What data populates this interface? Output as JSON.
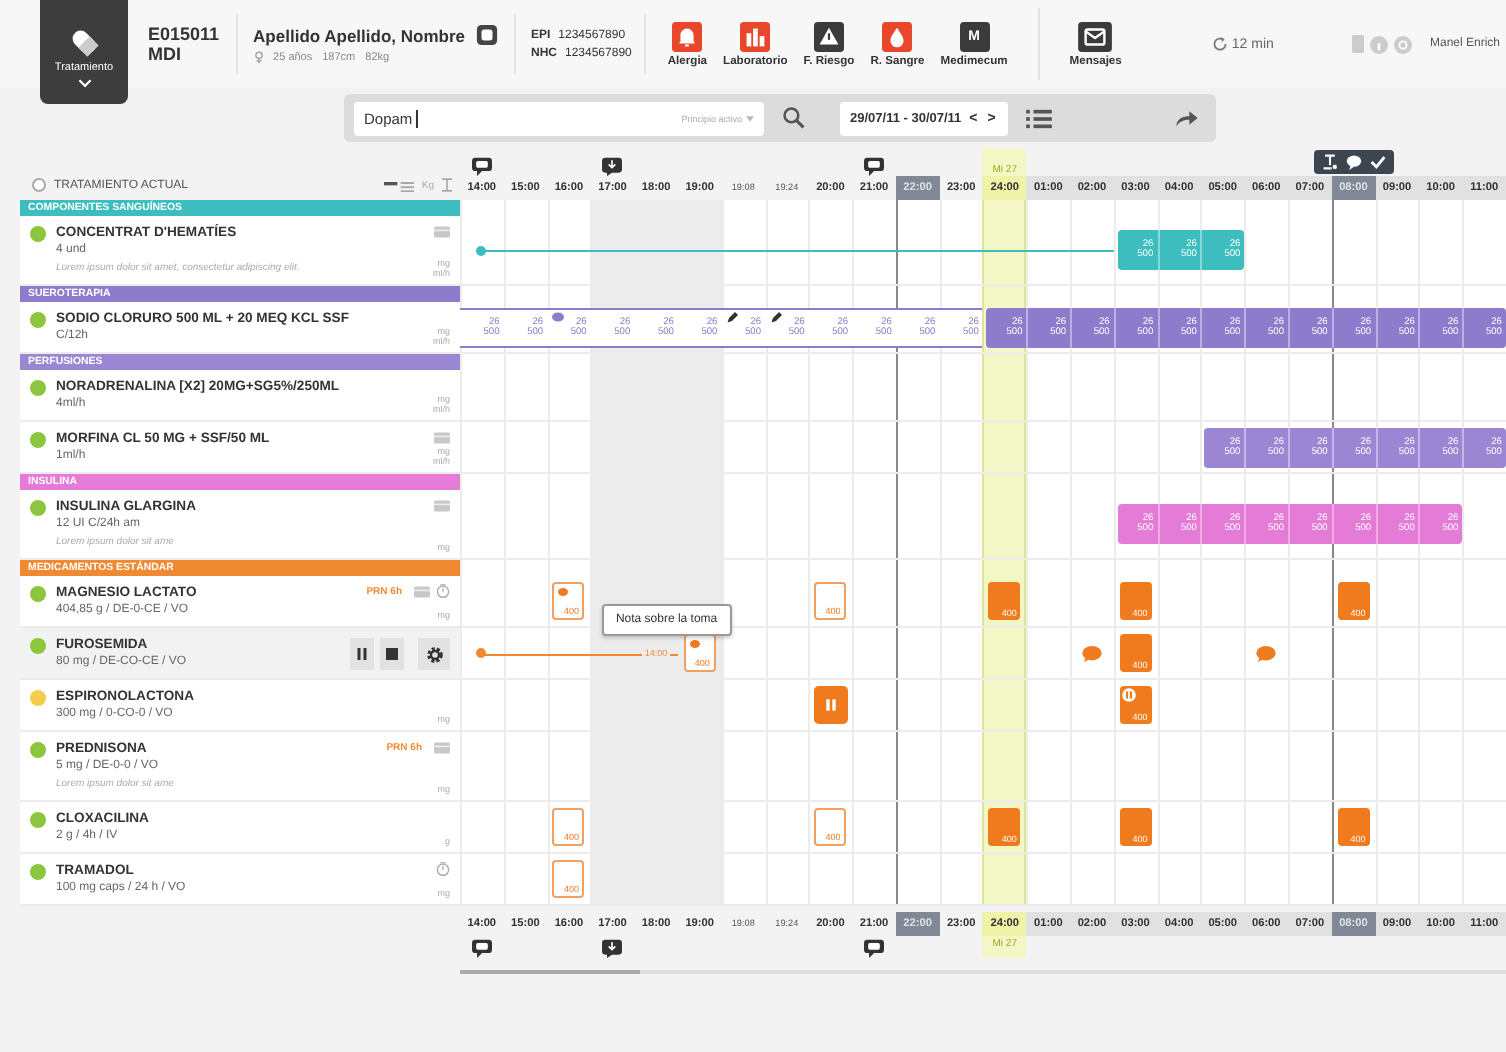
{
  "header": {
    "tab": {
      "label": "Tratamiento"
    },
    "bed": {
      "code": "E015011",
      "unit": "MDI"
    },
    "patient": {
      "name": "Apellido Apellido, Nombre",
      "age": "25 años",
      "height": "187cm",
      "weight": "82kg"
    },
    "ids": [
      {
        "label": "EPI",
        "value": "1234567890"
      },
      {
        "label": "NHC",
        "value": "1234567890"
      }
    ],
    "shortcuts": [
      {
        "label": "Alergia",
        "kind": "bell",
        "alert": true
      },
      {
        "label": "Laboratorio",
        "kind": "chart",
        "alert": true
      },
      {
        "label": "F. Riesgo",
        "kind": "warning",
        "alert": false
      },
      {
        "label": "R. Sangre",
        "kind": "drop",
        "alert": true
      },
      {
        "label": "Medimecum",
        "kind": "letter",
        "glyph": "M",
        "alert": false
      }
    ],
    "messages": {
      "label": "Mensajes"
    },
    "refresh": "12 min",
    "user": "Manel Enrich"
  },
  "search": {
    "value": "Dopam",
    "filter": "Principio activo",
    "dates": "29/07/11 - 30/07/11",
    "prev": "<",
    "next": ">"
  },
  "list_header": {
    "title": "TRATAMIENTO ACTUAL",
    "checked": false,
    "weight_unit": "Kg"
  },
  "columns": [
    {
      "label": "14:00",
      "kind": "hour",
      "flag": {
        "kind": "comment"
      },
      "shaded": false
    },
    {
      "label": "15:00",
      "kind": "hour",
      "shaded": false
    },
    {
      "label": "16:00",
      "kind": "hour",
      "shaded": false
    },
    {
      "label": "17:00",
      "kind": "hour",
      "flag": {
        "kind": "download"
      },
      "shaded": true
    },
    {
      "label": "18:00",
      "kind": "hour",
      "shaded": true
    },
    {
      "label": "19:00",
      "kind": "hour",
      "shaded": true
    },
    {
      "label": "19:08",
      "kind": "sub",
      "shaded": false
    },
    {
      "label": "19:24",
      "kind": "sub",
      "shaded": false
    },
    {
      "label": "20:00",
      "kind": "hour",
      "shaded": false
    },
    {
      "label": "21:00",
      "kind": "hour",
      "flag": {
        "kind": "comment"
      },
      "shaded": false
    },
    {
      "label": "22:00",
      "kind": "marker",
      "shaded": false
    },
    {
      "label": "23:00",
      "kind": "hour",
      "shaded": false
    },
    {
      "label": "24:00",
      "kind": "now",
      "day": "Mi 27",
      "shaded": false
    },
    {
      "label": "01:00",
      "kind": "next",
      "shaded": false
    },
    {
      "label": "02:00",
      "kind": "next",
      "shaded": false
    },
    {
      "label": "03:00",
      "kind": "next",
      "shaded": false
    },
    {
      "label": "04:00",
      "kind": "next",
      "shaded": false
    },
    {
      "label": "05:00",
      "kind": "next",
      "shaded": false
    },
    {
      "label": "06:00",
      "kind": "next",
      "shaded": false
    },
    {
      "label": "07:00",
      "kind": "next",
      "shaded": false
    },
    {
      "label": "08:00",
      "kind": "marker",
      "toolbar": true,
      "shaded": false
    },
    {
      "label": "09:00",
      "kind": "next",
      "shaded": false
    },
    {
      "label": "10:00",
      "kind": "next",
      "shaded": false
    },
    {
      "label": "11:00",
      "kind": "next",
      "shaded": false
    }
  ],
  "rows": [
    {
      "kind": "category",
      "label": "COMPONENTES SANGUÍNEOS",
      "color": "#3dbdbd"
    },
    {
      "kind": "drug",
      "color": "#8cc63f",
      "name": "CONCENTRAT D'HEMATÍES",
      "detail": "4 und",
      "note": "Lorem ipsum dolor sit amet, consectetur adipiscing elit.",
      "card": true,
      "timer": false,
      "units": [
        "mg",
        "ml/h"
      ],
      "hovered": false,
      "cells": [
        {
          "kind": "line-start"
        },
        {
          "kind": "line"
        },
        {
          "kind": "line"
        },
        {
          "kind": "line"
        },
        {
          "kind": "line"
        },
        {
          "kind": "line"
        },
        {
          "kind": "line"
        },
        {
          "kind": "line"
        },
        {
          "kind": "line"
        },
        {
          "kind": "line"
        },
        {
          "kind": "line"
        },
        {
          "kind": "line"
        },
        {
          "kind": "line"
        },
        {
          "kind": "line"
        },
        {
          "kind": "line"
        },
        {
          "kind": "bar",
          "dose": "26",
          "volume": "500"
        },
        {
          "kind": "bar",
          "dose": "26",
          "volume": "500"
        },
        {
          "kind": "bar",
          "dose": "26",
          "volume": "500"
        },
        {
          "kind": "none"
        },
        {
          "kind": "none"
        },
        {
          "kind": "none"
        },
        {
          "kind": "none"
        },
        {
          "kind": "none"
        },
        {
          "kind": "none"
        }
      ]
    },
    {
      "kind": "category",
      "label": "SUEROTERAPIA",
      "color": "#8d7bcb"
    },
    {
      "kind": "drug",
      "color": "#8cc63f",
      "name": "SODIO CLORURO 500 ML + 20 MEQ KCL SSF",
      "detail": "C/12h",
      "card": false,
      "timer": false,
      "units": [
        "mg",
        "ml/h"
      ],
      "hovered": false,
      "cells": [
        {
          "kind": "light",
          "dose": "26",
          "volume": "500"
        },
        {
          "kind": "light",
          "dose": "26",
          "volume": "500"
        },
        {
          "kind": "light",
          "dose": "26",
          "volume": "500",
          "annotation": {
            "kind": "comment"
          }
        },
        {
          "kind": "light",
          "dose": "26",
          "volume": "500"
        },
        {
          "kind": "light",
          "dose": "26",
          "volume": "500"
        },
        {
          "kind": "light",
          "dose": "26",
          "volume": "500"
        },
        {
          "kind": "light",
          "dose": "26",
          "volume": "500",
          "annotation": {
            "kind": "pencil"
          }
        },
        {
          "kind": "light",
          "dose": "26",
          "volume": "500",
          "annotation": {
            "kind": "pencil"
          }
        },
        {
          "kind": "light",
          "dose": "26",
          "volume": "500"
        },
        {
          "kind": "light",
          "dose": "26",
          "volume": "500"
        },
        {
          "kind": "light",
          "dose": "26",
          "volume": "500"
        },
        {
          "kind": "light",
          "dose": "26",
          "volume": "500"
        },
        {
          "kind": "bar",
          "dose": "26",
          "volume": "500"
        },
        {
          "kind": "bar",
          "dose": "26",
          "volume": "500"
        },
        {
          "kind": "bar",
          "dose": "26",
          "volume": "500"
        },
        {
          "kind": "bar",
          "dose": "26",
          "volume": "500"
        },
        {
          "kind": "bar",
          "dose": "26",
          "volume": "500"
        },
        {
          "kind": "bar",
          "dose": "26",
          "volume": "500"
        },
        {
          "kind": "bar",
          "dose": "26",
          "volume": "500"
        },
        {
          "kind": "bar",
          "dose": "26",
          "volume": "500"
        },
        {
          "kind": "bar",
          "dose": "26",
          "volume": "500"
        },
        {
          "kind": "bar",
          "dose": "26",
          "volume": "500"
        },
        {
          "kind": "bar",
          "dose": "26",
          "volume": "500"
        },
        {
          "kind": "bar",
          "dose": "26",
          "volume": "500"
        }
      ]
    },
    {
      "kind": "category",
      "label": "PERFUSIONES",
      "color": "#9a86d3"
    },
    {
      "kind": "drug",
      "color": "#8cc63f",
      "name": "NORADRENALINA [X2] 20MG+SG5%/250ML",
      "detail": "4ml/h",
      "card": false,
      "timer": false,
      "units": [
        "mg",
        "ml/h"
      ],
      "hovered": false,
      "cells": [
        {
          "kind": "none"
        },
        {
          "kind": "none"
        },
        {
          "kind": "none"
        },
        {
          "kind": "none"
        },
        {
          "kind": "none"
        },
        {
          "kind": "none"
        },
        {
          "kind": "none"
        },
        {
          "kind": "none"
        },
        {
          "kind": "none"
        },
        {
          "kind": "none"
        },
        {
          "kind": "none"
        },
        {
          "kind": "none"
        },
        {
          "kind": "none"
        },
        {
          "kind": "none"
        },
        {
          "kind": "none"
        },
        {
          "kind": "none"
        },
        {
          "kind": "none"
        },
        {
          "kind": "none"
        },
        {
          "kind": "none"
        },
        {
          "kind": "none"
        },
        {
          "kind": "none"
        },
        {
          "kind": "none"
        },
        {
          "kind": "none"
        },
        {
          "kind": "none"
        }
      ]
    },
    {
      "kind": "drug",
      "color": "#8cc63f",
      "name": "MORFINA CL 50 MG + SSF/50 ML",
      "detail": "1ml/h",
      "card": true,
      "timer": false,
      "units": [
        "mg",
        "ml/h"
      ],
      "hovered": false,
      "cells": [
        {
          "kind": "none"
        },
        {
          "kind": "none"
        },
        {
          "kind": "none"
        },
        {
          "kind": "none"
        },
        {
          "kind": "none"
        },
        {
          "kind": "none"
        },
        {
          "kind": "none"
        },
        {
          "kind": "none"
        },
        {
          "kind": "none"
        },
        {
          "kind": "none"
        },
        {
          "kind": "none"
        },
        {
          "kind": "none"
        },
        {
          "kind": "none"
        },
        {
          "kind": "none"
        },
        {
          "kind": "none"
        },
        {
          "kind": "none"
        },
        {
          "kind": "none"
        },
        {
          "kind": "bar",
          "dose": "26",
          "volume": "500"
        },
        {
          "kind": "bar",
          "dose": "26",
          "volume": "500"
        },
        {
          "kind": "bar",
          "dose": "26",
          "volume": "500"
        },
        {
          "kind": "bar",
          "dose": "26",
          "volume": "500"
        },
        {
          "kind": "bar",
          "dose": "26",
          "volume": "500"
        },
        {
          "kind": "bar",
          "dose": "26",
          "volume": "500"
        },
        {
          "kind": "bar",
          "dose": "26",
          "volume": "500"
        }
      ]
    },
    {
      "kind": "category",
      "label": "INSULINA",
      "color": "#e37bd7"
    },
    {
      "kind": "drug",
      "color": "#8cc63f",
      "name": "INSULINA GLARGINA",
      "detail": "12 UI C/24h am",
      "note": "Lorem ipsum dolor sit ame",
      "card": true,
      "timer": false,
      "units": [
        "mg"
      ],
      "hovered": false,
      "cells": [
        {
          "kind": "none"
        },
        {
          "kind": "none"
        },
        {
          "kind": "none"
        },
        {
          "kind": "none"
        },
        {
          "kind": "none"
        },
        {
          "kind": "none"
        },
        {
          "kind": "none"
        },
        {
          "kind": "none"
        },
        {
          "kind": "none"
        },
        {
          "kind": "none"
        },
        {
          "kind": "none"
        },
        {
          "kind": "none"
        },
        {
          "kind": "none"
        },
        {
          "kind": "none"
        },
        {
          "kind": "none"
        },
        {
          "kind": "bar",
          "dose": "26",
          "volume": "500"
        },
        {
          "kind": "bar",
          "dose": "26",
          "volume": "500"
        },
        {
          "kind": "bar",
          "dose": "26",
          "volume": "500"
        },
        {
          "kind": "bar",
          "dose": "26",
          "volume": "500"
        },
        {
          "kind": "bar",
          "dose": "26",
          "volume": "500"
        },
        {
          "kind": "bar",
          "dose": "26",
          "volume": "500"
        },
        {
          "kind": "bar",
          "dose": "26",
          "volume": "500"
        },
        {
          "kind": "bar",
          "dose": "26",
          "volume": "500"
        },
        {
          "kind": "none"
        }
      ]
    },
    {
      "kind": "category",
      "label": "MEDICAMENTOS ESTÁNDAR",
      "color": "#f08a32"
    },
    {
      "kind": "drug",
      "color": "#8cc63f",
      "name": "MAGNESIO LACTATO",
      "detail": "404,85 g / DE-0-CE / VO",
      "prn": "PRN 6h",
      "card": true,
      "timer": true,
      "units": [
        "mg"
      ],
      "hovered": false,
      "cells": [
        {
          "kind": "none"
        },
        {
          "kind": "none"
        },
        {
          "kind": "outline",
          "amount": "400",
          "dot": true
        },
        {
          "kind": "none"
        },
        {
          "kind": "none"
        },
        {
          "kind": "none"
        },
        {
          "kind": "none"
        },
        {
          "kind": "none"
        },
        {
          "kind": "outline",
          "amount": "400",
          "dot": false
        },
        {
          "kind": "none"
        },
        {
          "kind": "none"
        },
        {
          "kind": "none"
        },
        {
          "kind": "filled",
          "amount": "400"
        },
        {
          "kind": "none"
        },
        {
          "kind": "none"
        },
        {
          "kind": "filled",
          "amount": "400"
        },
        {
          "kind": "none"
        },
        {
          "kind": "none"
        },
        {
          "kind": "none"
        },
        {
          "kind": "none"
        },
        {
          "kind": "filled",
          "amount": "400"
        },
        {
          "kind": "none"
        },
        {
          "kind": "none"
        },
        {
          "kind": "none"
        }
      ]
    },
    {
      "kind": "drug",
      "color": "#8cc63f",
      "name": "FUROSEMIDA",
      "detail": "80 mg / DE-CO-CE / VO",
      "hovered": true,
      "cells": [
        {
          "kind": "line-start"
        },
        {
          "kind": "line"
        },
        {
          "kind": "line"
        },
        {
          "kind": "line"
        },
        {
          "kind": "line",
          "text": "14:00"
        },
        {
          "kind": "outline",
          "amount": "400",
          "dot": true,
          "note": "Nota sobre la toma"
        },
        {
          "kind": "none"
        },
        {
          "kind": "none"
        },
        {
          "kind": "none"
        },
        {
          "kind": "none"
        },
        {
          "kind": "none"
        },
        {
          "kind": "none"
        },
        {
          "kind": "none"
        },
        {
          "kind": "none"
        },
        {
          "kind": "comment"
        },
        {
          "kind": "filled",
          "amount": "400"
        },
        {
          "kind": "none"
        },
        {
          "kind": "none"
        },
        {
          "kind": "comment"
        },
        {
          "kind": "none"
        },
        {
          "kind": "none"
        },
        {
          "kind": "none"
        },
        {
          "kind": "none"
        },
        {
          "kind": "none"
        }
      ]
    },
    {
      "kind": "drug",
      "color": "#f5cd4c",
      "name": "ESPIRONOLACTONA",
      "detail": "300 mg / 0-CO-0 / VO",
      "card": false,
      "timer": false,
      "units": [
        "mg"
      ],
      "hovered": false,
      "cells": [
        {
          "kind": "none"
        },
        {
          "kind": "none"
        },
        {
          "kind": "none"
        },
        {
          "kind": "none"
        },
        {
          "kind": "none"
        },
        {
          "kind": "none"
        },
        {
          "kind": "none"
        },
        {
          "kind": "none"
        },
        {
          "kind": "paused"
        },
        {
          "kind": "none"
        },
        {
          "kind": "none"
        },
        {
          "kind": "none"
        },
        {
          "kind": "none"
        },
        {
          "kind": "none"
        },
        {
          "kind": "none"
        },
        {
          "kind": "filled",
          "amount": "400",
          "paused": true
        },
        {
          "kind": "none"
        },
        {
          "kind": "none"
        },
        {
          "kind": "none"
        },
        {
          "kind": "none"
        },
        {
          "kind": "none"
        },
        {
          "kind": "none"
        },
        {
          "kind": "none"
        },
        {
          "kind": "none"
        }
      ]
    },
    {
      "kind": "drug",
      "color": "#8cc63f",
      "name": "PREDNISONA",
      "detail": "5 mg / DE-0-0 / VO",
      "note": "Lorem ipsum dolor sit ame",
      "prn": "PRN 6h",
      "card": true,
      "timer": false,
      "units": [
        "mg"
      ],
      "hovered": false,
      "cells": [
        {
          "kind": "none"
        },
        {
          "kind": "none"
        },
        {
          "kind": "none"
        },
        {
          "kind": "none"
        },
        {
          "kind": "none"
        },
        {
          "kind": "none"
        },
        {
          "kind": "none"
        },
        {
          "kind": "none"
        },
        {
          "kind": "none"
        },
        {
          "kind": "none"
        },
        {
          "kind": "none"
        },
        {
          "kind": "none"
        },
        {
          "kind": "none"
        },
        {
          "kind": "none"
        },
        {
          "kind": "none"
        },
        {
          "kind": "none"
        },
        {
          "kind": "none"
        },
        {
          "kind": "none"
        },
        {
          "kind": "none"
        },
        {
          "kind": "none"
        },
        {
          "kind": "none"
        },
        {
          "kind": "none"
        },
        {
          "kind": "none"
        },
        {
          "kind": "none"
        }
      ]
    },
    {
      "kind": "drug",
      "color": "#8cc63f",
      "name": "CLOXACILINA",
      "detail": "2 g / 4h / IV",
      "card": false,
      "timer": false,
      "units": [
        "g"
      ],
      "hovered": false,
      "cells": [
        {
          "kind": "none"
        },
        {
          "kind": "none"
        },
        {
          "kind": "outline",
          "amount": "400",
          "dot": false
        },
        {
          "kind": "none"
        },
        {
          "kind": "none"
        },
        {
          "kind": "none"
        },
        {
          "kind": "none"
        },
        {
          "kind": "none"
        },
        {
          "kind": "outline",
          "amount": "400",
          "dot": false
        },
        {
          "kind": "none"
        },
        {
          "kind": "none"
        },
        {
          "kind": "none"
        },
        {
          "kind": "filled",
          "amount": "400"
        },
        {
          "kind": "none"
        },
        {
          "kind": "none"
        },
        {
          "kind": "filled",
          "amount": "400"
        },
        {
          "kind": "none"
        },
        {
          "kind": "none"
        },
        {
          "kind": "none"
        },
        {
          "kind": "none"
        },
        {
          "kind": "filled",
          "amount": "400"
        },
        {
          "kind": "none"
        },
        {
          "kind": "none"
        },
        {
          "kind": "none"
        }
      ]
    },
    {
      "kind": "drug",
      "color": "#8cc63f",
      "name": "TRAMADOL",
      "detail": "100 mg caps / 24 h / VO",
      "card": false,
      "timer": true,
      "units": [
        "mg"
      ],
      "hovered": false,
      "cells": [
        {
          "kind": "none"
        },
        {
          "kind": "none"
        },
        {
          "kind": "outline",
          "amount": "400",
          "dot": false
        },
        {
          "kind": "none"
        },
        {
          "kind": "none"
        },
        {
          "kind": "none"
        },
        {
          "kind": "none"
        },
        {
          "kind": "none"
        },
        {
          "kind": "none"
        },
        {
          "kind": "none"
        },
        {
          "kind": "none"
        },
        {
          "kind": "none"
        },
        {
          "kind": "none"
        },
        {
          "kind": "none"
        },
        {
          "kind": "none"
        },
        {
          "kind": "none"
        },
        {
          "kind": "none"
        },
        {
          "kind": "none"
        },
        {
          "kind": "none"
        },
        {
          "kind": "none"
        },
        {
          "kind": "none"
        },
        {
          "kind": "none"
        },
        {
          "kind": "none"
        },
        {
          "kind": "none"
        }
      ]
    }
  ],
  "axis_bottom": [
    {
      "label": "14:00",
      "flag": {
        "kind": "comment"
      }
    },
    {
      "label": "15:00"
    },
    {
      "label": "16:00"
    },
    {
      "label": "17:00",
      "flag": {
        "kind": "download"
      }
    },
    {
      "label": "18:00"
    },
    {
      "label": "19:00"
    },
    {
      "label": "19:08"
    },
    {
      "label": "19:24"
    },
    {
      "label": "20:00"
    },
    {
      "label": "21:00",
      "flag": {
        "kind": "comment"
      }
    },
    {
      "label": "22:00"
    },
    {
      "label": "23:00"
    },
    {
      "label": "24:00",
      "day": "Mi 27"
    },
    {
      "label": "01:00"
    },
    {
      "label": "02:00"
    },
    {
      "label": "03:00"
    },
    {
      "label": "04:00"
    },
    {
      "label": "05:00"
    },
    {
      "label": "06:00"
    },
    {
      "label": "07:00"
    },
    {
      "label": "08:00"
    },
    {
      "label": "09:00"
    },
    {
      "label": "10:00"
    },
    {
      "label": "11:00"
    }
  ]
}
